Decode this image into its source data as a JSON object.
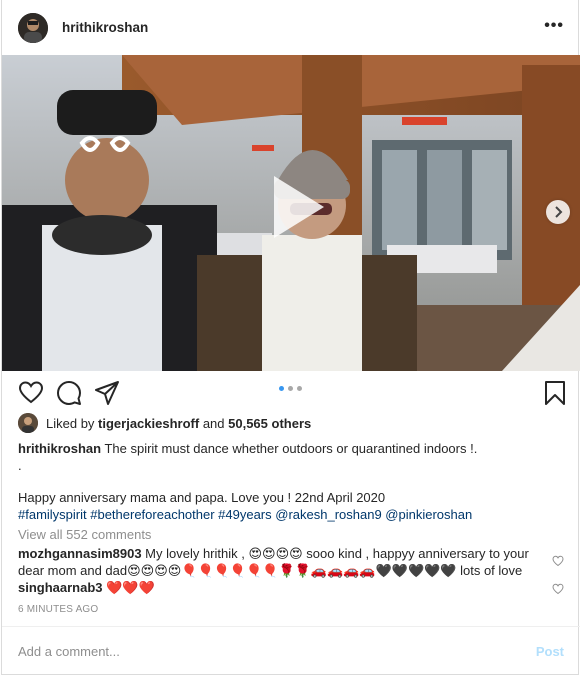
{
  "header": {
    "username": "hrithikroshan",
    "more_label": "•••"
  },
  "media": {
    "slide_count": 3,
    "active_slide": 1
  },
  "likes": {
    "prefix": "Liked by ",
    "user": "tigerjackieshroff",
    "middle": " and ",
    "count": "50,565 others"
  },
  "caption": {
    "username": "hrithikroshan",
    "line1": " The spirit must dance whether outdoors or quarantined indoors !.",
    "line2": ".",
    "line3": "Happy anniversary mama and papa. Love you ! 22nd April 2020",
    "line4": "#familyspirit #betherefore­achother #49years @rakesh_roshan9 @pinkieroshan"
  },
  "view_all": "View all 552 comments",
  "comments": [
    {
      "username": "mozhgannasim8903",
      "text": " My lovely hrithik , 😍😍😍😍 sooo kind , happyy anniversary to your dear mom and dad😍😍😍😍🎈🎈🎈🎈🎈🎈🌹🌹🚗🚗🚗🚗🖤🖤🖤🖤🖤 lots of love"
    },
    {
      "username": "singhaarnab3",
      "text": " ❤️❤️❤️"
    }
  ],
  "timestamp": "6 MINUTES AGO",
  "add_comment": {
    "placeholder": "Add a comment...",
    "post_label": "Post"
  },
  "colors": {
    "accent": "#3897f0",
    "link": "#00376b",
    "muted": "#8e8e8e",
    "post_disabled": "#b2dffc"
  }
}
